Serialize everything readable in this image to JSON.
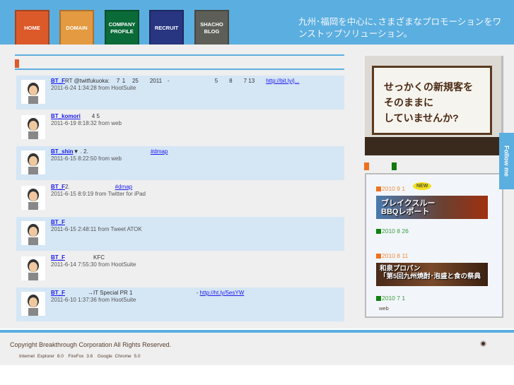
{
  "nav": [
    {
      "label": "HOME",
      "color": "#dc5a2a"
    },
    {
      "label": "DOMAIN",
      "color": "#e49a40"
    },
    {
      "label": "COMPANY\nPROFILE",
      "color": "#0a6a38"
    },
    {
      "label": "RECRUIT",
      "color": "#283580"
    },
    {
      "label": "SHACHO\nBLOG",
      "color": "#5e5e58"
    }
  ],
  "tagline": "九州･福岡を中心に､さまざまなプロモーションをワンストップソリューション。",
  "tweets": [
    {
      "user": "BT_F",
      "text": "RT @twitfukuoka:　７１　25　　2011　-　　　　　　　　5　　8　　7 13　　",
      "link": "http://bit.ly/j...",
      "meta": "2011-6-24 1:34:28 from HootSuite"
    },
    {
      "user": "BT_komori",
      "text": "　　4 5",
      "link": "",
      "meta": "2011-6-19 8:18:32 from web"
    },
    {
      "user": "BT_shin",
      "text": "▼ . 2.　　　　　　　　　　　",
      "link": "#dmap",
      "meta": "2011-6-15 8:22:50 from web"
    },
    {
      "user": "BT_F",
      "text": "2.　　　　　　　　",
      "link": "#dmap",
      "meta": "2011-6-15 8:9:19 from Twitter for iPad"
    },
    {
      "user": "BT_F",
      "text": "",
      "link": "",
      "meta": "2011-6-15 2:48:11 from Tweet ATOK"
    },
    {
      "user": "BT_F",
      "text": "　　　　　KFC",
      "link": "",
      "meta": "2011-6-14 7:55:30 from HootSuite"
    },
    {
      "user": "BT_F",
      "text": "　　　　→IT Special PR  1　　　　　　　　　　　 - ",
      "link": "http://ht.ly/5esYW",
      "meta": "2011-6-10 1:37:36 from HootSuite"
    }
  ],
  "banner": "せっかくの新規客を\nそのままに\nしていませんか?",
  "news": {
    "new_badge": "NEW",
    "items": [
      {
        "date": "2010 9 1",
        "image": "ブレイクスルー\nBBQレポート"
      },
      {
        "date": "2010 8 26"
      },
      {
        "date": "2010 8 11",
        "image": "和泉プロパン\n「第5回九州焼酎･泡盛と食の祭典"
      },
      {
        "date": "2010 7 1",
        "text": "web"
      }
    ]
  },
  "follow": "Follow me",
  "footer": {
    "copyright": "Copyright Breakthrough Corporation All Rights Reserved.",
    "browsers": "Internet Explorer 8.0　FireFox 3.6　Google Chrome 5.0"
  }
}
